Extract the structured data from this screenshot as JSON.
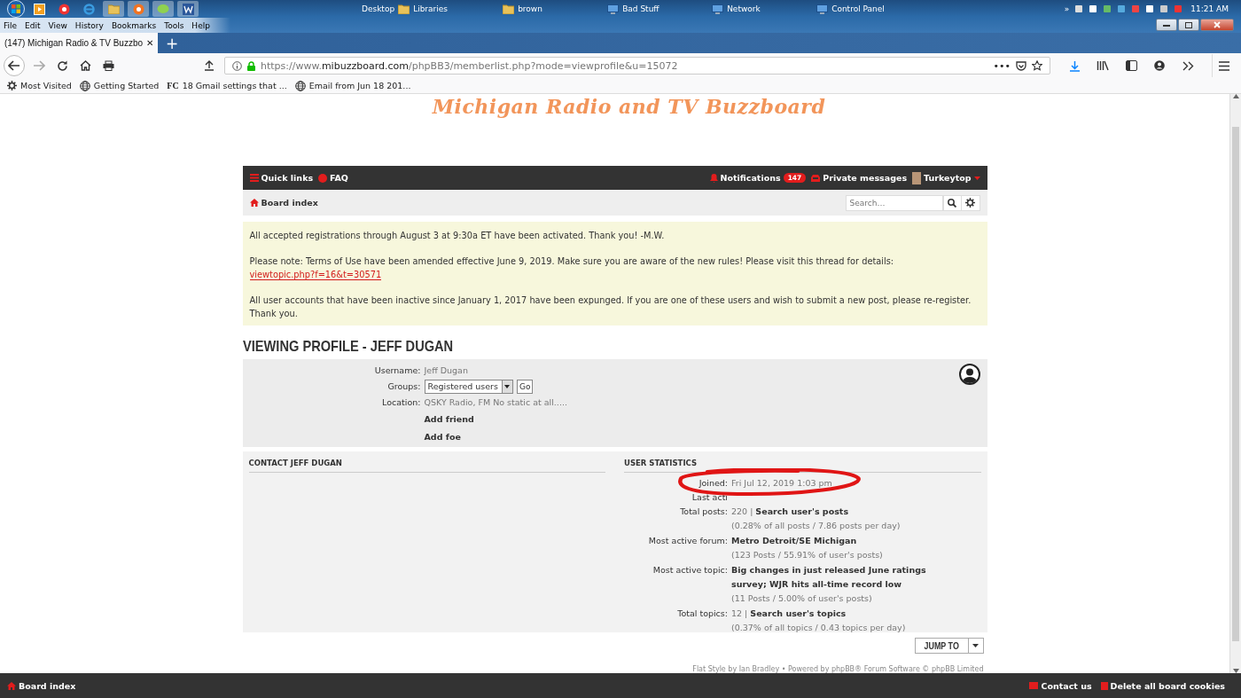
{
  "taskbar": {
    "toolbars": [
      {
        "label": "Desktop"
      },
      {
        "label": "Libraries"
      },
      {
        "label": "brown"
      },
      {
        "label": "Bad Stuff"
      },
      {
        "label": "Network"
      },
      {
        "label": "Control Panel"
      }
    ],
    "overflow": "»",
    "clock": "11:21 AM"
  },
  "menu_bar": [
    "File",
    "Edit",
    "View",
    "History",
    "Bookmarks",
    "Tools",
    "Help"
  ],
  "tabs": [
    {
      "label": "(147) Michigan Radio & TV Buzzbo",
      "close": "✕",
      "selected": true
    }
  ],
  "new_tab": "+",
  "address_bar": {
    "scheme": "https://www.",
    "domain": "mibuzzboard.com",
    "path": "/phpBB3/memberlist.php?mode=viewprofile&u=15072",
    "more": "•••"
  },
  "bookmarks": [
    {
      "label": "Most Visited"
    },
    {
      "label": "Getting Started"
    },
    {
      "label": "18 Gmail settings that ...",
      "icon_text": "FC"
    },
    {
      "label": "Email from Jun 18 201..."
    }
  ],
  "site_title": "Michigan Radio and TV Buzzboard",
  "navbar": {
    "quick_links": "Quick links",
    "faq": "FAQ",
    "notifications": "Notifications",
    "notification_count": "147",
    "private_messages": "Private messages",
    "username": "Turkeytop"
  },
  "breadcrumb": "Board index",
  "search": {
    "placeholder": "Search…"
  },
  "notices": [
    {
      "text": "All accepted registrations through August 3 at 9:30a ET have been activated. Thank you! -M.W."
    },
    {
      "text": "Please note: Terms of Use have been amended effective June 9, 2019. Make sure you are aware of the new rules! Please visit this thread for details:",
      "link": "viewtopic.php?f=16&t=30571"
    },
    {
      "text": "All user accounts that have been inactive since January 1, 2017 have been expunged. If you are one of these users and wish to submit a new post, please re-register. Thank you."
    }
  ],
  "profile": {
    "heading": "VIEWING PROFILE - JEFF DUGAN",
    "username_label": "Username:",
    "username": "Jeff Dugan",
    "groups_label": "Groups:",
    "group": "Registered users",
    "go": "Go",
    "location_label": "Location:",
    "location": "QSKY Radio, FM No static at all.....",
    "actions": [
      "Add friend",
      "Add foe"
    ]
  },
  "contact": {
    "heading": "CONTACT JEFF DUGAN"
  },
  "statistics": {
    "heading": "USER STATISTICS",
    "rows": [
      {
        "label": "Joined:",
        "value": "Fri Jul 12, 2019 1:03 pm",
        "circled": true
      },
      {
        "label": "Last acti",
        "circled": false
      },
      {
        "label": "Total posts:",
        "value": "220 |",
        "link": "Search user's posts",
        "detail": "(0.28% of all posts / 7.86 posts per day)",
        "circled": false
      },
      {
        "label": "Most active forum:",
        "link": "Metro Detroit/SE Michigan",
        "detail": "(123 Posts / 55.91% of user's posts)",
        "circled": false
      },
      {
        "label": "Most active topic:",
        "link": "Big changes in just released June ratings survey; WJR hits all-time record low",
        "detail": "(11 Posts / 5.00% of user's posts)",
        "circled": false
      },
      {
        "label": "Total topics:",
        "value": "12 |",
        "link": "Search user's topics",
        "detail": "(0.37% of all topics / 0.43 topics per day)",
        "circled": false
      }
    ]
  },
  "jump_to": "JUMP TO",
  "credits": "Flat Style by Ian Bradley • Powered by phpBB® Forum Software © phpBB Limited",
  "footer": {
    "board_index": "Board index",
    "contact": "Contact us",
    "delete_cookies": "Delete all board cookies"
  }
}
